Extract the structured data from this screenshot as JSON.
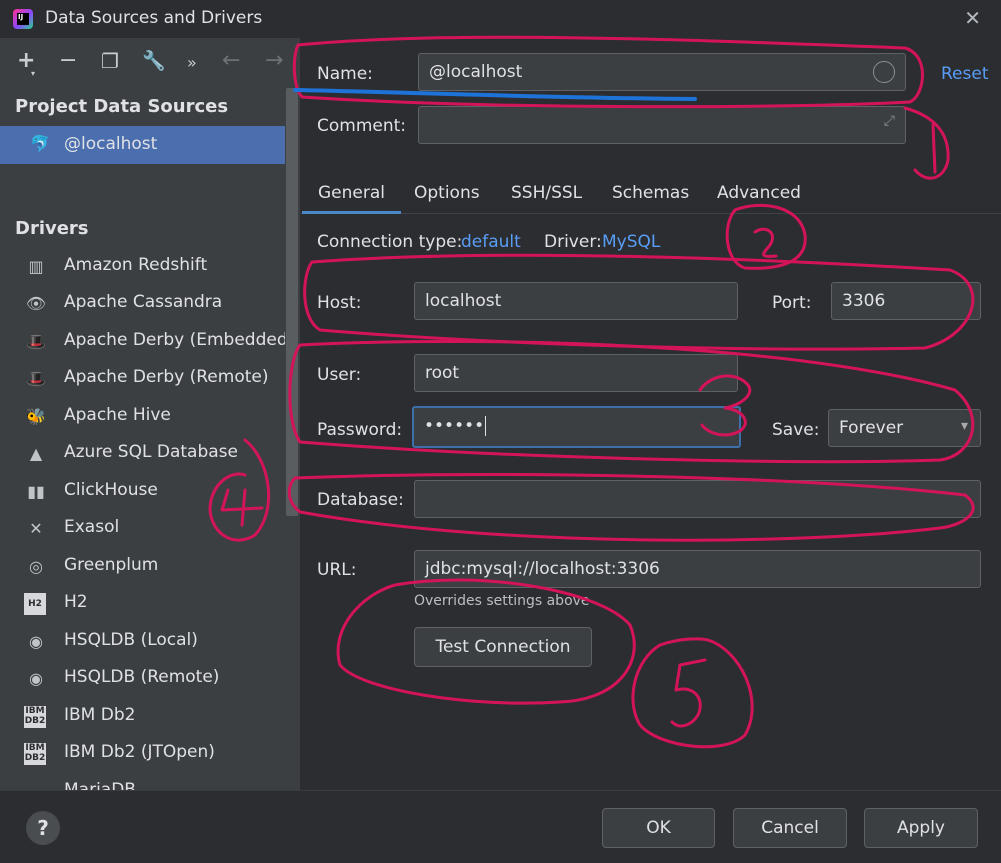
{
  "window": {
    "title": "Data Sources and Drivers",
    "app_icon_text": "IJ"
  },
  "toolbar": {
    "add": "+",
    "remove": "−",
    "copy": "❐",
    "settings": "🔧",
    "more": "»",
    "back": "←",
    "forward": "→"
  },
  "left": {
    "project_title": "Project Data Sources",
    "project_items": [
      {
        "label": "@localhost"
      }
    ],
    "drivers_title": "Drivers",
    "drivers": [
      {
        "label": "Amazon Redshift"
      },
      {
        "label": "Apache Cassandra"
      },
      {
        "label": "Apache Derby (Embedded)"
      },
      {
        "label": "Apache Derby (Remote)"
      },
      {
        "label": "Apache Hive"
      },
      {
        "label": "Azure SQL Database"
      },
      {
        "label": "ClickHouse"
      },
      {
        "label": "Exasol"
      },
      {
        "label": "Greenplum"
      },
      {
        "label": "H2",
        "icon_text": "H2"
      },
      {
        "label": "HSQLDB (Local)"
      },
      {
        "label": "HSQLDB (Remote)"
      },
      {
        "label": "IBM Db2",
        "icon_text": "IBM DB2"
      },
      {
        "label": "IBM Db2 (JTOpen)",
        "icon_text": "IBM DB2"
      },
      {
        "label": "MariaDB"
      }
    ]
  },
  "form": {
    "name_label": "Name:",
    "name_value": "@localhost",
    "reset": "Reset",
    "comment_label": "Comment:",
    "comment_value": "",
    "tabs": [
      "General",
      "Options",
      "SSH/SSL",
      "Schemas",
      "Advanced"
    ],
    "connection_type_label": "Connection type:",
    "connection_type_value": "default",
    "driver_label": "Driver:",
    "driver_value": "MySQL",
    "host_label": "Host:",
    "host_value": "localhost",
    "port_label": "Port:",
    "port_value": "3306",
    "user_label": "User:",
    "user_value": "root",
    "password_label": "Password:",
    "password_value": "••••••",
    "save_label": "Save:",
    "save_value": "Forever",
    "database_label": "Database:",
    "database_value": "",
    "url_label": "URL:",
    "url_value": "jdbc:mysql://localhost:3306",
    "url_hint": "Overrides settings above",
    "test_connection": "Test Connection"
  },
  "buttons": {
    "help": "?",
    "ok": "OK",
    "cancel": "Cancel",
    "apply": "Apply"
  },
  "annotations": {
    "numbers": [
      "1",
      "2",
      "3",
      "4",
      "5"
    ],
    "color": "#d4145a"
  }
}
